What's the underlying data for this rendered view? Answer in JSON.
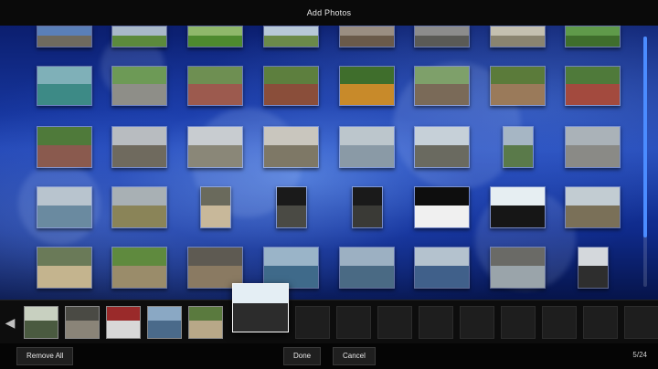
{
  "window": {
    "title": "Add Photos"
  },
  "gallery": {
    "rows": [
      [
        {
          "sky": "#5a7fb8",
          "ground": "#6f6a5e"
        },
        {
          "sky": "#a9b9c9",
          "ground": "#5c8a3c"
        },
        {
          "sky": "#8fb86a",
          "ground": "#4e8a2e"
        },
        {
          "sky": "#b7c8d8",
          "ground": "#6b8a4a"
        },
        {
          "sky": "#9a8e82",
          "ground": "#6a5a4a"
        },
        {
          "sky": "#8c8c8c",
          "ground": "#5a5a56"
        },
        {
          "sky": "#c4c0b0",
          "ground": "#8a8470"
        },
        {
          "sky": "#5f9a4a",
          "ground": "#3f6e2c"
        }
      ],
      [
        {
          "sky": "#7fb0b8",
          "ground": "#3d8a86"
        },
        {
          "sky": "#6d9a56",
          "ground": "#8e8e88"
        },
        {
          "sky": "#6e8f52",
          "ground": "#9c5a4e"
        },
        {
          "sky": "#5d7f3e",
          "ground": "#8a4e3a"
        },
        {
          "sky": "#3f6e2c",
          "ground": "#c88a2a"
        },
        {
          "sky": "#7ea06a",
          "ground": "#7a6a58"
        },
        {
          "sky": "#5b7b3a",
          "ground": "#9a7a5a"
        },
        {
          "sky": "#4f7a3a",
          "ground": "#a34a3e"
        }
      ],
      [
        {
          "sky": "#4f7a3a",
          "ground": "#8a5a4e"
        },
        {
          "sky": "#b8bcc0",
          "ground": "#6f6a5e"
        },
        {
          "sky": "#c8ccd0",
          "ground": "#8a8778"
        },
        {
          "sky": "#c9c6be",
          "ground": "#7e7866"
        },
        {
          "sky": "#bcc6cc",
          "ground": "#8a9aa6"
        },
        {
          "sky": "#c6d0d8",
          "ground": "#6a6a60"
        },
        {
          "sky": "#a6b6c4",
          "ground": "#5a7a4a"
        },
        {
          "sky": "#aab2b8",
          "ground": "#8a8a86"
        }
      ],
      [
        {
          "sky": "#b8c4ce",
          "ground": "#6a8aa0"
        },
        {
          "sky": "#a8b0b4",
          "ground": "#8a8458"
        },
        {
          "sky": "#6a6a5c",
          "ground": "#c8b89a"
        },
        {
          "sky": "#1a1a1a",
          "ground": "#4a4a44"
        },
        {
          "sky": "#1a1a1a",
          "ground": "#3a3a36"
        },
        {
          "sky": "#0e0e0e",
          "ground": "#f0f0f0"
        },
        {
          "sky": "#e6eef2",
          "ground": "#161616"
        },
        {
          "sky": "#c2ccd2",
          "ground": "#7a7058"
        }
      ],
      [
        {
          "sky": "#6a7a58",
          "ground": "#c4b48e"
        },
        {
          "sky": "#5f8a3e",
          "ground": "#9a8c6a"
        },
        {
          "sky": "#5e5a52",
          "ground": "#8a7a62"
        },
        {
          "sky": "#9ab4c8",
          "ground": "#3f6a8a"
        },
        {
          "sky": "#9cb0c2",
          "ground": "#4a6a84"
        },
        {
          "sky": "#b4c2ce",
          "ground": "#40608a"
        },
        {
          "sky": "#6a6a66",
          "ground": "#9aa4aa"
        },
        {
          "sky": "#d4d8dc",
          "ground": "#2e2e2e"
        }
      ]
    ]
  },
  "tray": {
    "prev_icon": "chevron-left-icon",
    "next_icon": "chevron-right-icon",
    "filled": [
      {
        "sky": "#c8d0c0",
        "ground": "#4a5a40"
      },
      {
        "sky": "#4a4a44",
        "ground": "#8a8478"
      },
      {
        "sky": "#9a2a2a",
        "ground": "#d8d8d8"
      },
      {
        "sky": "#8aa8c4",
        "ground": "#4a6a8a"
      },
      {
        "sky": "#5a7a3e",
        "ground": "#b8a888"
      }
    ],
    "empty_count": 9,
    "dragged": {
      "sky": "#e4eef4",
      "ground": "#2c2c2c"
    }
  },
  "actions": {
    "remove_all_label": "Remove All",
    "done_label": "Done",
    "cancel_label": "Cancel",
    "count_label": "5/24"
  }
}
